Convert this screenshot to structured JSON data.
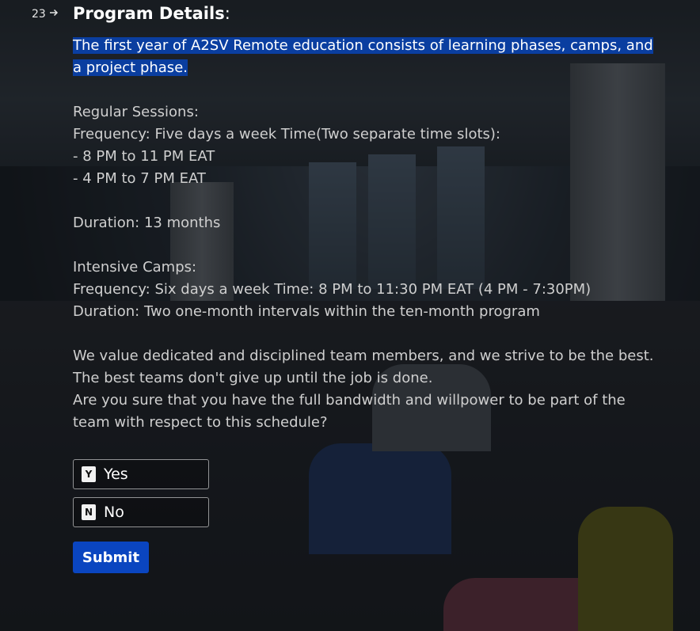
{
  "question": {
    "number": "23",
    "arrow_icon": "arrow-right-icon",
    "title": "Program Details",
    "title_suffix": ":"
  },
  "description": {
    "highlighted_line_1": "The first year of A2SV Remote education consists of learning phases, camps, and",
    "highlighted_line_2": "a project phase.",
    "lines": [
      "Regular Sessions:",
      "Frequency: Five days a week Time(Two separate time slots):",
      "- 8 PM to 11 PM EAT",
      "- 4 PM to 7 PM EAT",
      "",
      "Duration: 13 months",
      "",
      "Intensive Camps:",
      "Frequency: Six days a week Time: 8 PM to 11:30 PM EAT (4 PM - 7:30PM)",
      "Duration: Two one-month intervals within the ten-month program",
      "",
      "We value dedicated and disciplined team members, and we strive to be the best.",
      "The best teams don't give up until the job is done.",
      "Are you sure that you have the full bandwidth and willpower to be part of the",
      "team with respect to this schedule?"
    ]
  },
  "choices": [
    {
      "key": "Y",
      "label": "Yes"
    },
    {
      "key": "N",
      "label": "No"
    }
  ],
  "submit_label": "Submit",
  "colors": {
    "highlight": "#0a3ea0",
    "submit": "#0a45c0"
  }
}
